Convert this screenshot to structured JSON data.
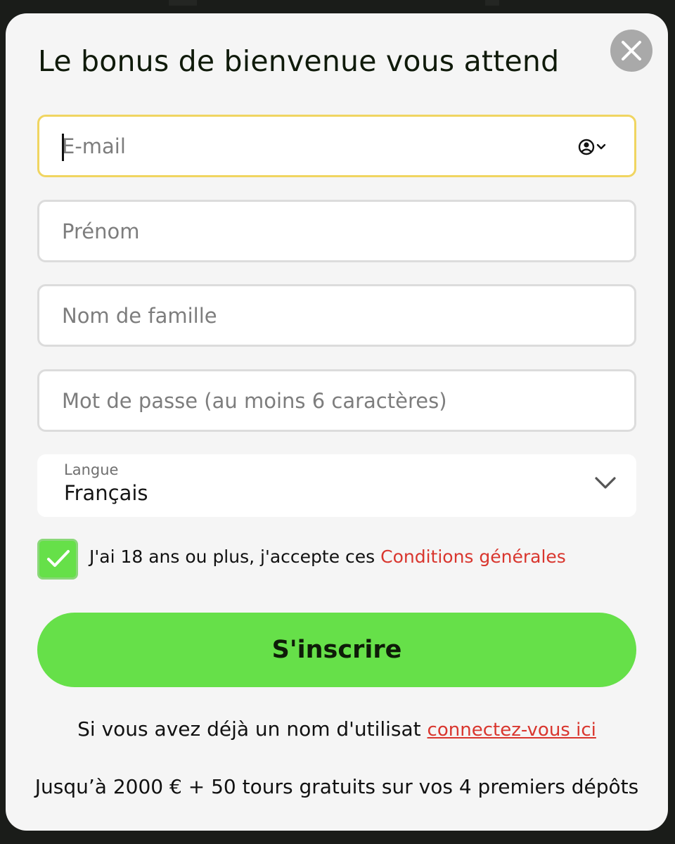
{
  "modal": {
    "title": "Le bonus de bienvenue vous attend"
  },
  "form": {
    "email": {
      "placeholder": "E-mail",
      "value": ""
    },
    "first_name": {
      "placeholder": "Prénom",
      "value": ""
    },
    "last_name": {
      "placeholder": "Nom de famille",
      "value": ""
    },
    "password": {
      "placeholder": "Mot de passe (au moins 6 caractères)",
      "value": ""
    },
    "language": {
      "label": "Langue",
      "value": "Français"
    },
    "terms": {
      "text": "J'ai 18 ans ou plus, j'accepte ces ",
      "link": "Conditions générales",
      "checked": true
    },
    "submit_label": "S'inscrire"
  },
  "footer": {
    "login_text": "Si vous avez déjà un nom d'utilisat ",
    "login_link": "connectez-vous ici",
    "promo": "Jusqu’à 2000 € + 50 tours gratuits sur vos 4 premiers dépôts"
  },
  "icons": {
    "close": "close-icon",
    "autofill": "contact-autofill-icon",
    "select_chevron": "chevron-down-icon",
    "checkbox_check": "checkmark-icon"
  },
  "colors": {
    "accent_green": "#66e049",
    "link_red": "#d9362e",
    "focus_border": "#f0d561"
  }
}
